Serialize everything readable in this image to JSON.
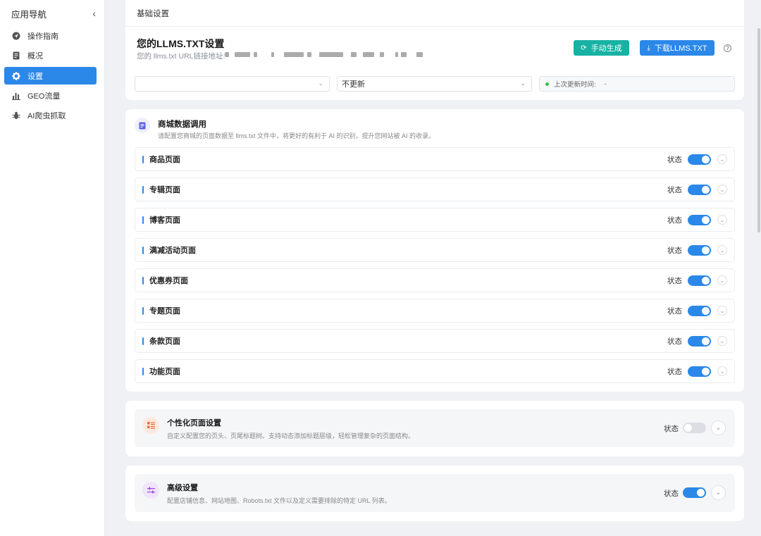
{
  "sidebar": {
    "title": "应用导航",
    "items": [
      {
        "label": "操作指南",
        "icon": "navigation-icon"
      },
      {
        "label": "概况",
        "icon": "document-icon"
      },
      {
        "label": "设置",
        "icon": "gear-icon"
      },
      {
        "label": "GEO流量",
        "icon": "bar-chart-icon"
      },
      {
        "label": "AI爬虫抓取",
        "icon": "bug-icon"
      }
    ],
    "active_index": 2
  },
  "header": {
    "page_title": "基础设置",
    "llms_title": "您的LLMS.TXT设置",
    "url_label": "您的 llms.txt URL链接地址:",
    "generate_label": "手动生成",
    "download_label": "下载LLMS.TXT"
  },
  "filters": {
    "select1_value": "",
    "select2_value": "不更新",
    "last_update_label": "上次更新时间:",
    "last_update_value": "-"
  },
  "mall": {
    "title": "商城数据调用",
    "desc": "请配置您商城的页面数据至 llms.txt 文件中，将更好的有利于 AI 的识别，提升您网站被 AI 的收录。",
    "status_label": "状态",
    "rows": [
      {
        "label": "商品页面",
        "enabled": true
      },
      {
        "label": "专辑页面",
        "enabled": true
      },
      {
        "label": "博客页面",
        "enabled": true
      },
      {
        "label": "满减活动页面",
        "enabled": true
      },
      {
        "label": "优惠券页面",
        "enabled": true
      },
      {
        "label": "专题页面",
        "enabled": true
      },
      {
        "label": "条款页面",
        "enabled": true
      },
      {
        "label": "功能页面",
        "enabled": true
      }
    ]
  },
  "personal": {
    "title": "个性化页面设置",
    "desc": "自定义配置您的页头、页尾标题树。支持动态添加标题层级，轻松管理复杂的页面结构。",
    "status_label": "状态",
    "enabled": false
  },
  "advanced": {
    "title": "高级设置",
    "desc": "配置店铺信息、网站地图、Robots.txt 文件以及定义需要排除的特定 URL 列表。",
    "status_label": "状态",
    "enabled": true
  },
  "colors": {
    "accent": "#2b88e8",
    "teal": "#17b2a3",
    "status_green": "#2bc34a"
  }
}
